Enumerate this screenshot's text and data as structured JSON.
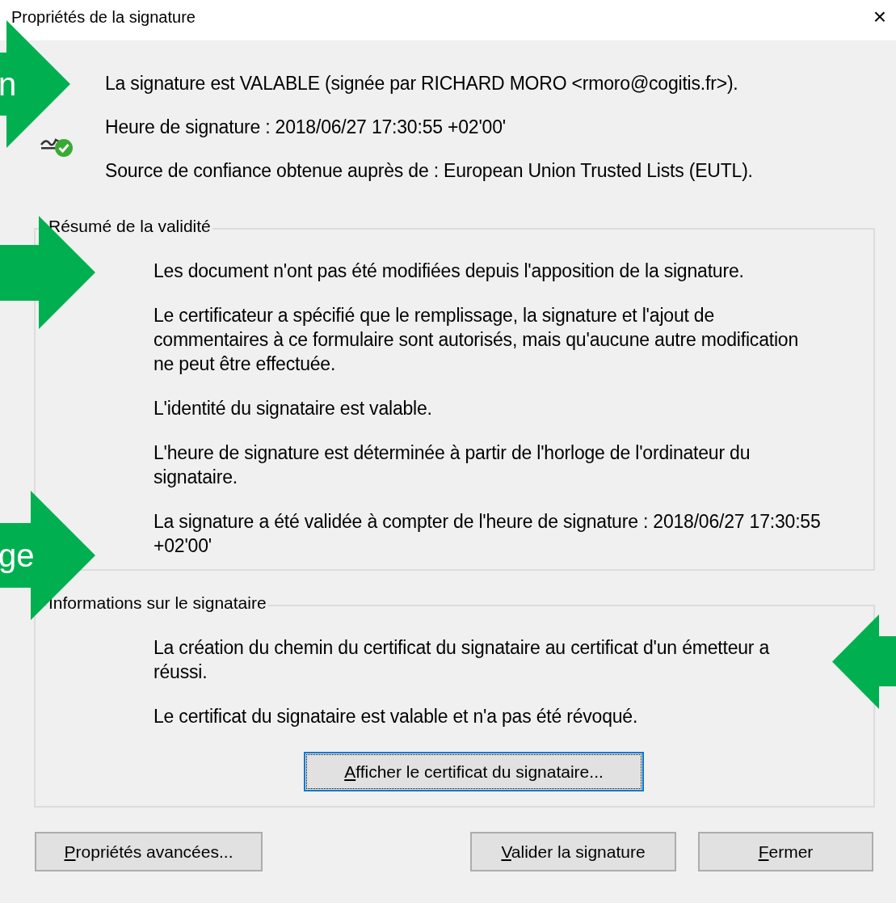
{
  "window": {
    "title": "Propriétés de la signature",
    "close": "×"
  },
  "status_lines": [
    "La signature est VALABLE (signée par RICHARD MORO <rmoro@cogitis.fr>).",
    "Heure de signature :  2018/06/27 17:30:55 +02'00'",
    "Source de confiance obtenue auprès de : European Union Trusted Lists (EUTL)."
  ],
  "groups": [
    {
      "title": "Résumé de la validité",
      "paragraphs": [
        "Les document n'ont pas été modifiées depuis l'apposition de la signature.",
        "Le certificateur a spécifié que le remplissage, la signature et l'ajout de commentaires à ce formulaire sont autorisés, mais qu'aucune autre modification ne peut être effectuée.",
        "L'identité du signataire est valable.",
        "L'heure de signature est déterminée à partir de l'horloge de l'ordinateur du signataire.",
        "La signature a été validée à compter de l'heure de signature : 2018/06/27 17:30:55 +02'00'"
      ]
    },
    {
      "title": "Informations sur le signataire",
      "paragraphs": [
        "La création du chemin du certificat du signataire au certificat d'un émetteur a réussi.",
        "Le certificat du signataire est valable et n'a pas été révoqué."
      ],
      "button": {
        "label": "Afficher le certificat du signataire...",
        "mnemonic": true,
        "focused": true
      }
    }
  ],
  "buttons": [
    {
      "label": "Propriétés avancées...",
      "mnemonic": true,
      "focused": false
    },
    {
      "label": "Valider la signature",
      "mnemonic": true,
      "focused": false
    },
    {
      "label": "Fermer",
      "mnemonic": true,
      "focused": false
    }
  ],
  "annotations": [
    {
      "kind": "right-arrow",
      "label": "n"
    },
    {
      "kind": "right-arrow"
    },
    {
      "kind": "right-arrow",
      "label": "ge"
    },
    {
      "kind": "left-arrow"
    }
  ]
}
